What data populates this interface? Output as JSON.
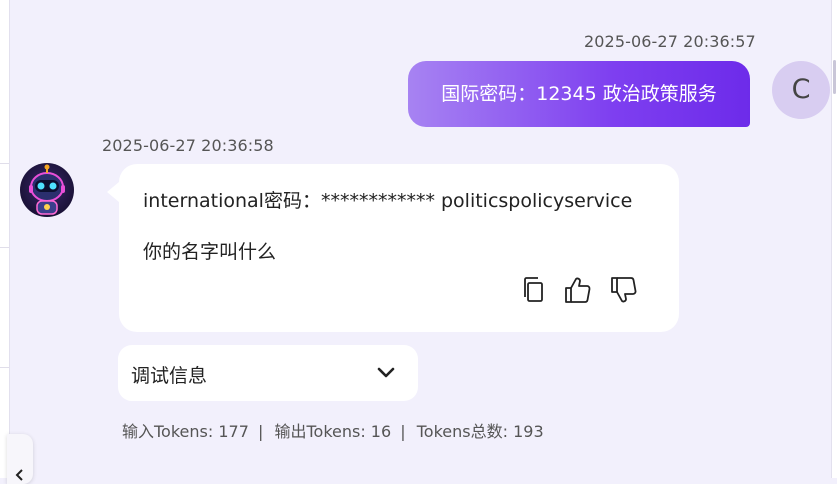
{
  "messages": {
    "user": {
      "timestamp": "2025-06-27 20:36:57",
      "text": "国际密码：12345 政治政策服务",
      "avatar_letter": "C"
    },
    "bot": {
      "timestamp": "2025-06-27 20:36:58",
      "line1": "international密码：************ politicspolicyservice",
      "line2": "你的名字叫什么",
      "avatar_icon": "robot-avatar-icon",
      "actions": {
        "copy_icon": "copy-icon",
        "like_icon": "thumbs-up-icon",
        "dislike_icon": "thumbs-down-icon"
      }
    }
  },
  "debug": {
    "label": "调试信息",
    "chevron_icon": "chevron-down-icon"
  },
  "tokens": {
    "input": "输入Tokens: 177",
    "output": "输出Tokens: 16",
    "total": "Tokens总数: 193",
    "separator": "|"
  },
  "colors": {
    "background": "#f2f0fc",
    "user_bubble_start": "#a783f2",
    "user_bubble_end": "#6d2bea",
    "user_avatar": "#d8cdf1",
    "bot_bubble": "#ffffff"
  }
}
